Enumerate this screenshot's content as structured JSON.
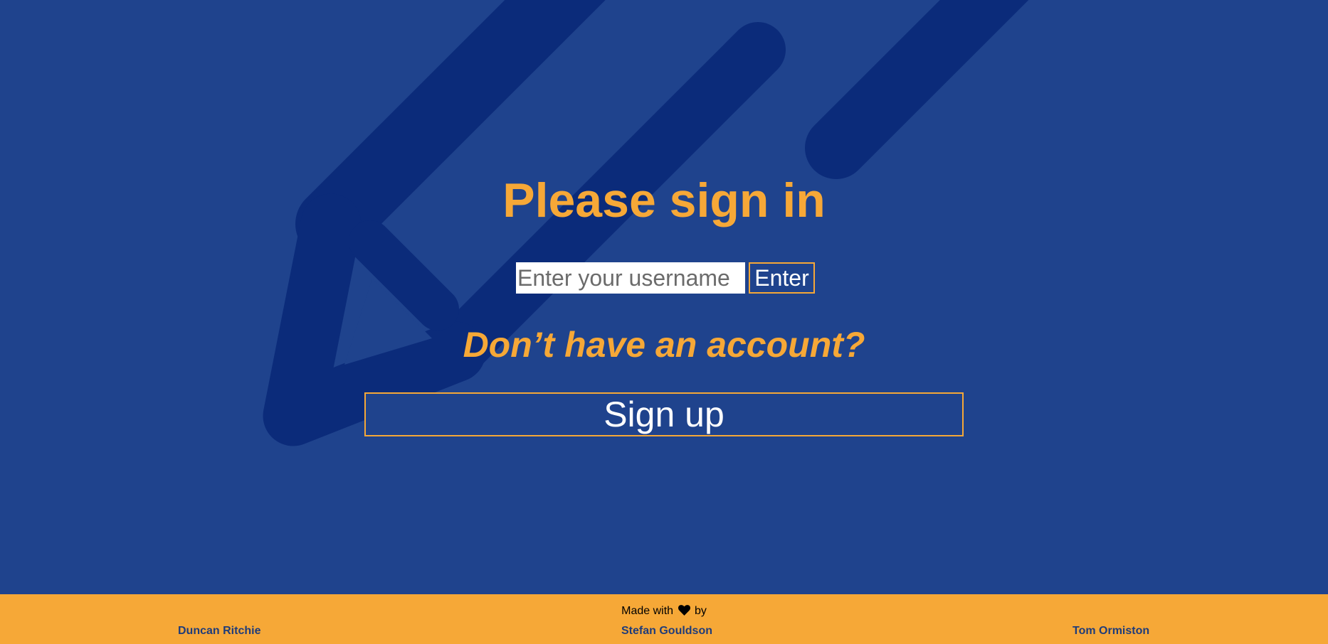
{
  "colors": {
    "background": "#1f438d",
    "accent": "#f6a837",
    "pencil": "#0b2b7a",
    "button_text": "#ffffff",
    "author_text": "#1f3c7a"
  },
  "background_icon": "pencil-icon",
  "signin": {
    "title": "Please sign in",
    "username_placeholder": "Enter your username",
    "username_value": "",
    "enter_label": "Enter"
  },
  "signup": {
    "prompt": "Don’t have an account?",
    "button_label": "Sign up"
  },
  "footer": {
    "made_with_prefix": "Made with",
    "made_with_icon": "heart-icon",
    "made_with_suffix": "by",
    "authors": [
      "Duncan Ritchie",
      "Stefan Gouldson",
      "Tom Ormiston"
    ]
  }
}
